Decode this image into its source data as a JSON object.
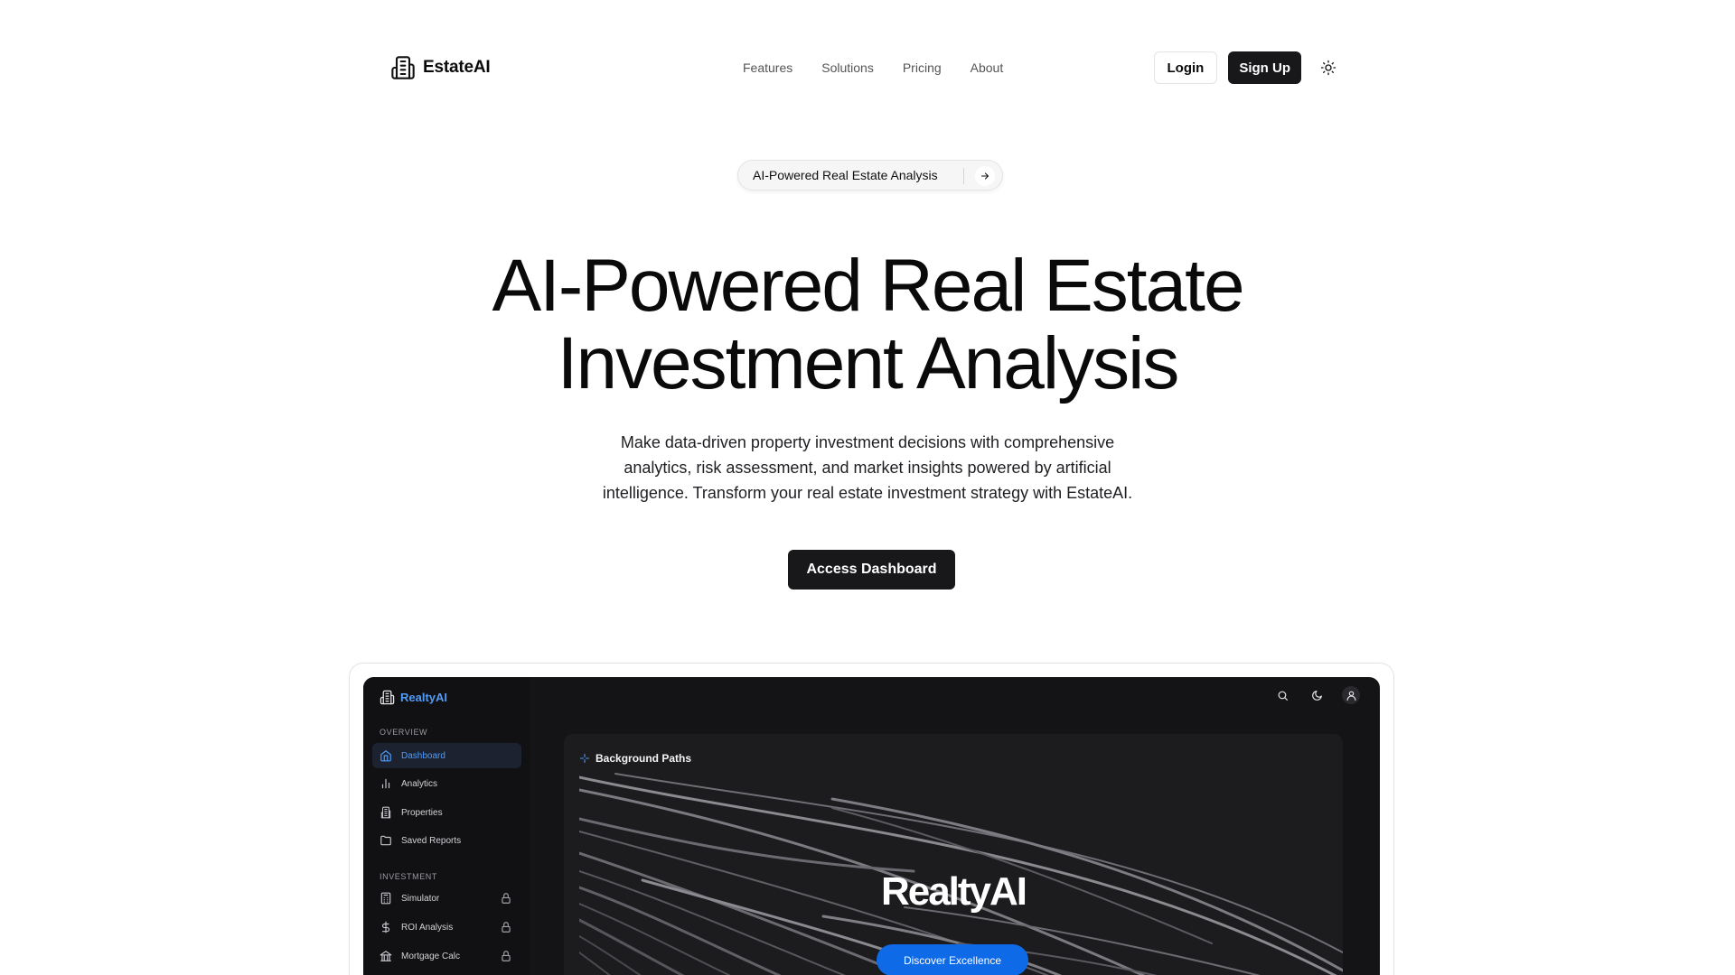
{
  "brand": {
    "name": "EstateAI",
    "icon": "building-icon"
  },
  "nav": [
    {
      "label": "Features"
    },
    {
      "label": "Solutions"
    },
    {
      "label": "Pricing"
    },
    {
      "label": "About"
    }
  ],
  "auth": {
    "login": "Login",
    "signup": "Sign Up",
    "theme_icon": "sun-icon"
  },
  "hero": {
    "badge": "AI-Powered Real Estate Analysis",
    "title_line1": "AI-Powered Real Estate",
    "title_line2": "Investment Analysis",
    "subtitle": "Make data-driven property investment decisions with comprehensive analytics, risk assessment, and market insights powered by artificial intelligence. Transform your real estate investment strategy with EstateAI.",
    "cta": "Access Dashboard"
  },
  "preview": {
    "brand": "RealtyAI",
    "sections": {
      "overview": "OVERVIEW",
      "investment": "INVESTMENT"
    },
    "overview_items": [
      {
        "label": "Dashboard",
        "icon": "home-icon",
        "active": true
      },
      {
        "label": "Analytics",
        "icon": "bar-chart-icon"
      },
      {
        "label": "Properties",
        "icon": "building-icon"
      },
      {
        "label": "Saved Reports",
        "icon": "folder-icon"
      }
    ],
    "investment_items": [
      {
        "label": "Simulator",
        "icon": "calculator-icon",
        "locked": true
      },
      {
        "label": "ROI Analysis",
        "icon": "dollar-icon",
        "locked": true
      },
      {
        "label": "Mortgage Calc",
        "icon": "bank-icon",
        "locked": true
      }
    ],
    "top_icons": [
      "search-icon",
      "moon-icon",
      "user-icon"
    ],
    "panel": {
      "title": "Background Paths",
      "headline": "RealtyAI",
      "button": "Discover Excellence"
    }
  },
  "colors": {
    "primary_dark": "#18181b",
    "preview_bg": "#141416",
    "preview_accent": "#4f9cf9",
    "discover_button": "#0f6ae8"
  }
}
